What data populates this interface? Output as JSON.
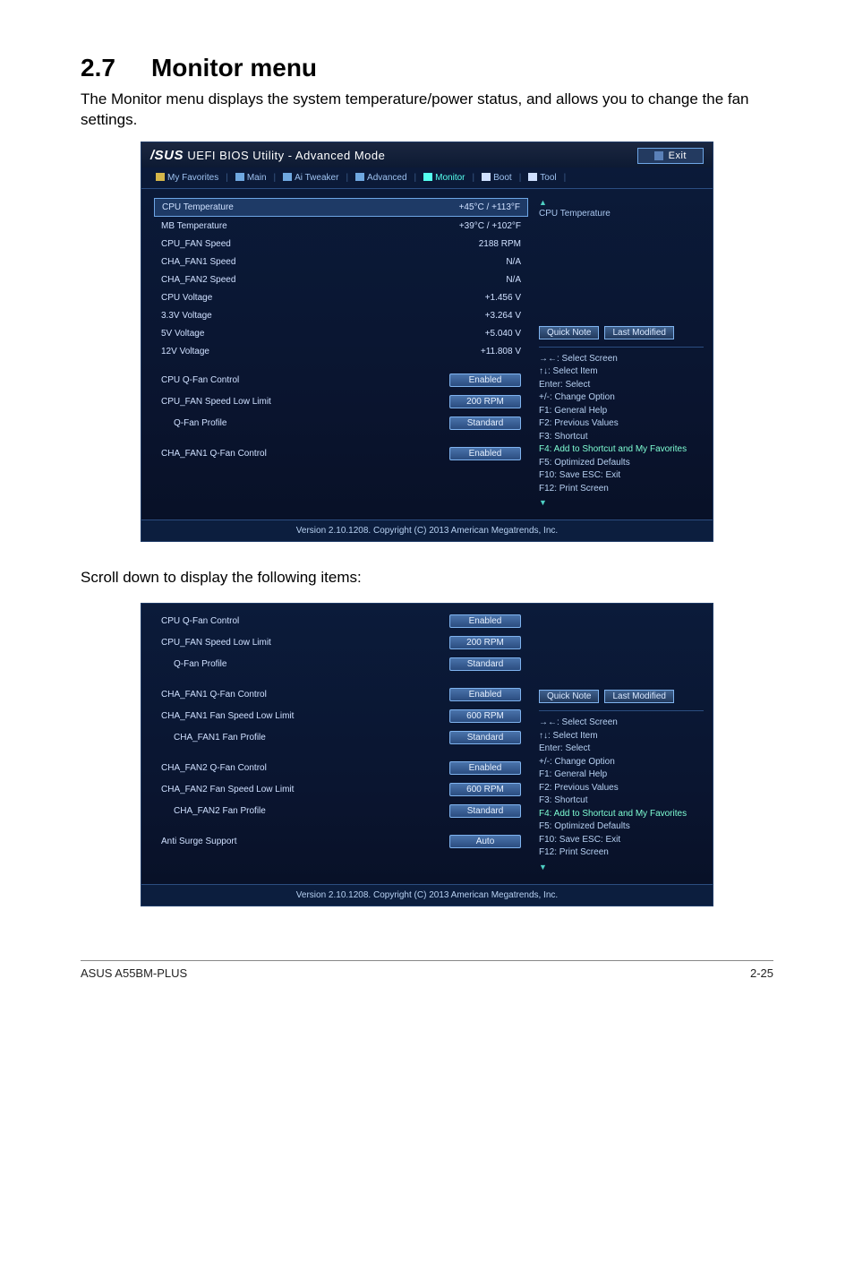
{
  "heading": {
    "number": "2.7",
    "title": "Monitor menu"
  },
  "intro": "The Monitor menu displays the system temperature/power status, and allows you to change the fan settings.",
  "midtext": "Scroll down to display the following items:",
  "footer": {
    "left": "ASUS A55BM-PLUS",
    "right": "2-25"
  },
  "bios_common": {
    "brand": "/SUS",
    "title": "UEFI BIOS Utility - Advanced Mode",
    "exit": "Exit",
    "tabs": [
      "My Favorites",
      "Main",
      "Ai Tweaker",
      "Advanced",
      "Monitor",
      "Boot",
      "Tool"
    ],
    "footer": "Version 2.10.1208. Copyright (C) 2013 American Megatrends, Inc.",
    "help_title": "CPU Temperature",
    "quick_note": "Quick Note",
    "last_modified": "Last Modified",
    "help_lines": [
      "→←: Select Screen",
      "↑↓: Select Item",
      "Enter: Select",
      "+/-: Change Option",
      "F1: General Help",
      "F2: Previous Values",
      "F3: Shortcut",
      "F4: Add to Shortcut and My Favorites",
      "F5: Optimized Defaults",
      "F10: Save  ESC: Exit",
      "F12: Print Screen"
    ]
  },
  "bios1": {
    "rows": [
      {
        "label": "CPU Temperature",
        "value": "+45°C / +113°F",
        "hl": true
      },
      {
        "label": "MB Temperature",
        "value": "+39°C / +102°F"
      },
      {
        "label": "CPU_FAN Speed",
        "value": "2188 RPM"
      },
      {
        "label": "CHA_FAN1 Speed",
        "value": "N/A"
      },
      {
        "label": "CHA_FAN2 Speed",
        "value": "N/A"
      },
      {
        "label": "CPU Voltage",
        "value": "+1.456 V"
      },
      {
        "label": "3.3V Voltage",
        "value": "+3.264 V"
      },
      {
        "label": "5V Voltage",
        "value": "+5.040 V"
      },
      {
        "label": "12V Voltage",
        "value": "+11.808 V"
      }
    ],
    "controls": [
      {
        "label": "CPU Q-Fan Control",
        "value": "Enabled"
      },
      {
        "label": "CPU_FAN Speed Low Limit",
        "value": "200 RPM"
      },
      {
        "label": "Q-Fan Profile",
        "value": "Standard",
        "indent": true
      },
      {
        "label": "CHA_FAN1 Q-Fan Control",
        "value": "Enabled",
        "gap": true
      }
    ]
  },
  "bios2": {
    "controls": [
      {
        "label": "CPU Q-Fan Control",
        "value": "Enabled"
      },
      {
        "label": "CPU_FAN Speed Low Limit",
        "value": "200 RPM"
      },
      {
        "label": "Q-Fan Profile",
        "value": "Standard",
        "indent": true
      },
      {
        "label": "CHA_FAN1 Q-Fan Control",
        "value": "Enabled",
        "gap": true
      },
      {
        "label": "CHA_FAN1 Fan Speed Low Limit",
        "value": "600 RPM"
      },
      {
        "label": "CHA_FAN1 Fan Profile",
        "value": "Standard",
        "indent": true
      },
      {
        "label": "CHA_FAN2 Q-Fan Control",
        "value": "Enabled",
        "gap": true
      },
      {
        "label": "CHA_FAN2 Fan Speed Low Limit",
        "value": "600 RPM"
      },
      {
        "label": "CHA_FAN2 Fan Profile",
        "value": "Standard",
        "indent": true
      },
      {
        "label": "Anti Surge Support",
        "value": "Auto",
        "gap": true
      }
    ]
  }
}
